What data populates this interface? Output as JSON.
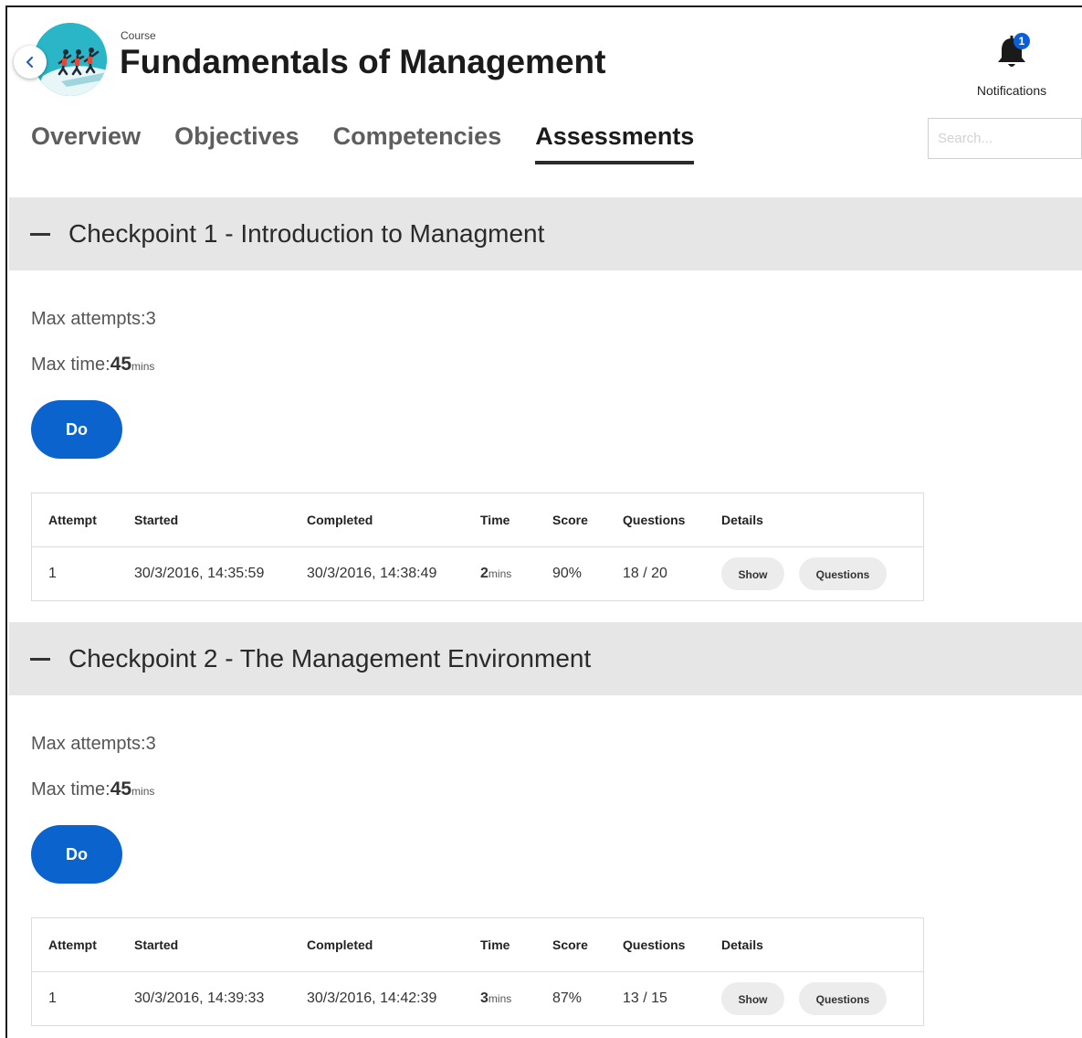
{
  "header": {
    "label": "Course",
    "title": "Fundamentals of Management",
    "back_icon": "chevron-left-icon",
    "logo_icon": "course-logo-illustration"
  },
  "notifications": {
    "count": "1",
    "label": "Notifications",
    "icon": "bell-icon",
    "badge_color": "#0b5ed7"
  },
  "tabs": [
    {
      "label": "Overview",
      "active": false
    },
    {
      "label": "Objectives",
      "active": false
    },
    {
      "label": "Competencies",
      "active": false
    },
    {
      "label": "Assessments",
      "active": true
    }
  ],
  "search": {
    "placeholder": "Search..."
  },
  "table_headers": {
    "attempt": "Attempt",
    "started": "Started",
    "completed": "Completed",
    "time": "Time",
    "score": "Score",
    "questions": "Questions",
    "details": "Details"
  },
  "checkpoints": [
    {
      "title": "Checkpoint 1 - Introduction to Managment",
      "max_attempts_label": "Max attempts:",
      "max_attempts": "3",
      "max_time_label": "Max time:",
      "max_time": "45",
      "max_time_unit": "mins",
      "do_label": "Do",
      "rows": [
        {
          "attempt": "1",
          "started": "30/3/2016, 14:35:59",
          "completed": "30/3/2016, 14:38:49",
          "time": "2",
          "time_unit": "mins",
          "score": "90%",
          "questions": "18 / 20",
          "show_label": "Show",
          "questions_label": "Questions"
        }
      ]
    },
    {
      "title": "Checkpoint 2 - The Management Environment",
      "max_attempts_label": "Max attempts:",
      "max_attempts": "3",
      "max_time_label": "Max time:",
      "max_time": "45",
      "max_time_unit": "mins",
      "do_label": "Do",
      "rows": [
        {
          "attempt": "1",
          "started": "30/3/2016, 14:39:33",
          "completed": "30/3/2016, 14:42:39",
          "time": "3",
          "time_unit": "mins",
          "score": "87%",
          "questions": "13 / 15",
          "show_label": "Show",
          "questions_label": "Questions"
        }
      ]
    }
  ],
  "colors": {
    "primary": "#0b63ce",
    "section_bg": "#e6e6e6",
    "logo_bg": "#2bb6c8"
  }
}
